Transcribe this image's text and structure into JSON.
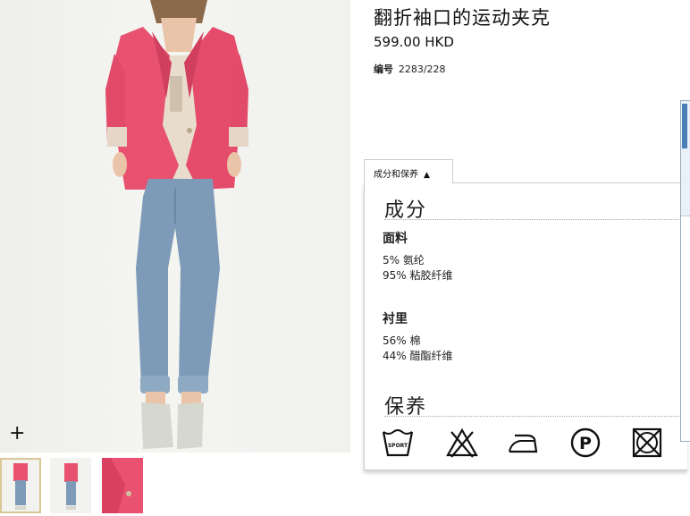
{
  "product": {
    "title": "翻折袖口的运动夹克",
    "price": "599.00 HKD",
    "ref_label": "编号",
    "ref_number": "2283/228"
  },
  "gallery": {
    "zoom_label": "+",
    "thumbnails": [
      "front-full",
      "front-full-alt",
      "detail-close-up"
    ]
  },
  "details_tab": {
    "label": "成分和保养",
    "arrow": "▲"
  },
  "composition": {
    "title": "成分",
    "outer_title": "面料",
    "outer": [
      "5% 氨纶",
      "95% 粘胶纤维"
    ],
    "lining_title": "衬里",
    "lining": [
      "56% 棉",
      "44% 醋酯纤维"
    ]
  },
  "care": {
    "title": "保养",
    "icon_wash_text": "SPORT",
    "icon_drycleaning_text": "P",
    "icons": [
      "machine-wash-sport-icon",
      "no-bleach-icon",
      "iron-low-icon",
      "dry-clean-p-icon",
      "no-tumble-dry-icon"
    ]
  },
  "colors": {
    "jacket": "#e8516f",
    "jeans": "#7d9bb8",
    "background": "#ffffff"
  }
}
